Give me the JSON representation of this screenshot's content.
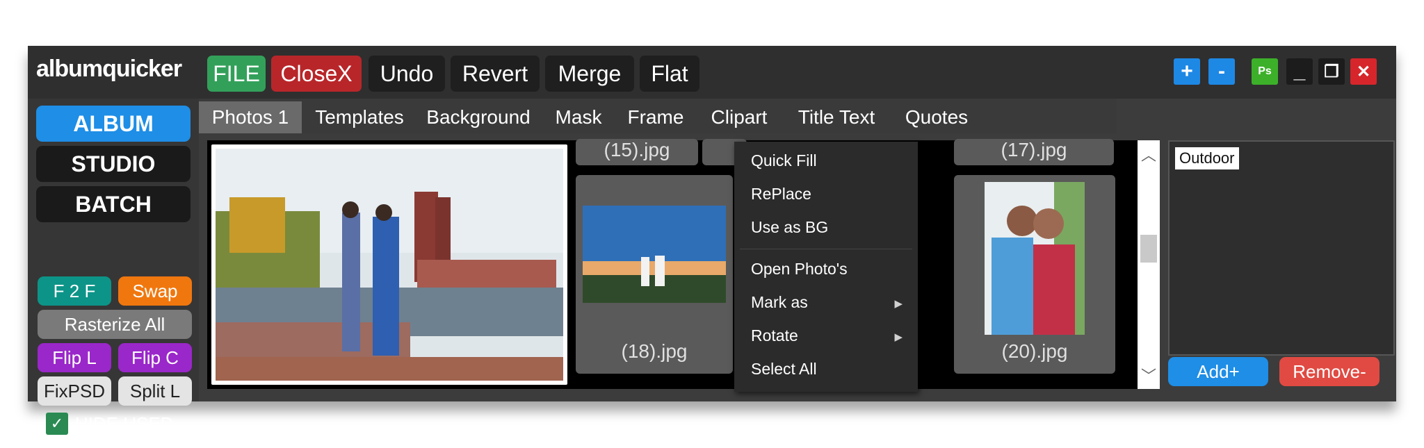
{
  "app": {
    "logo": "albumquicker"
  },
  "toolbar": {
    "file": "FILE",
    "close": "CloseX",
    "undo": "Undo",
    "revert": "Revert",
    "merge": "Merge",
    "flat": "Flat"
  },
  "window_controls": {
    "plus": "+",
    "minus": "-",
    "ps": "Ps",
    "minimize": "_",
    "restore": "❐",
    "close": "✕"
  },
  "sidebar": {
    "modes": [
      "ALBUM",
      "STUDIO",
      "BATCH"
    ],
    "buttons": {
      "f2f": "F 2 F",
      "swap": "Swap",
      "rasterize": "Rasterize All",
      "flip_l": "Flip L",
      "flip_c": "Flip C",
      "fixpsd": "FixPSD",
      "split_l": "Split L"
    },
    "hide_used": {
      "label": "HIDE USED",
      "checked": true
    }
  },
  "tabs": [
    "Photos 1",
    "Templates",
    "Background",
    "Mask",
    "Frame",
    "Clipart",
    "Title Text",
    "Quotes"
  ],
  "thumbnails": {
    "t15": "(15).jpg",
    "t17": "(17).jpg",
    "t18": "(18).jpg",
    "t20": "(20).jpg"
  },
  "context_menu": {
    "items": [
      "Quick Fill",
      "RePlace",
      "Use as BG",
      "Open Photo's",
      "Mark as",
      "Rotate",
      "Select All"
    ]
  },
  "right_panel": {
    "tag": "Outdoor",
    "add": "Add+",
    "remove": "Remove-"
  },
  "colors": {
    "accent_blue": "#1e8ee6",
    "file_green": "#33a05a",
    "close_red": "#b8262a",
    "swap_orange": "#f0770e",
    "flip_purple": "#9a27c9"
  }
}
